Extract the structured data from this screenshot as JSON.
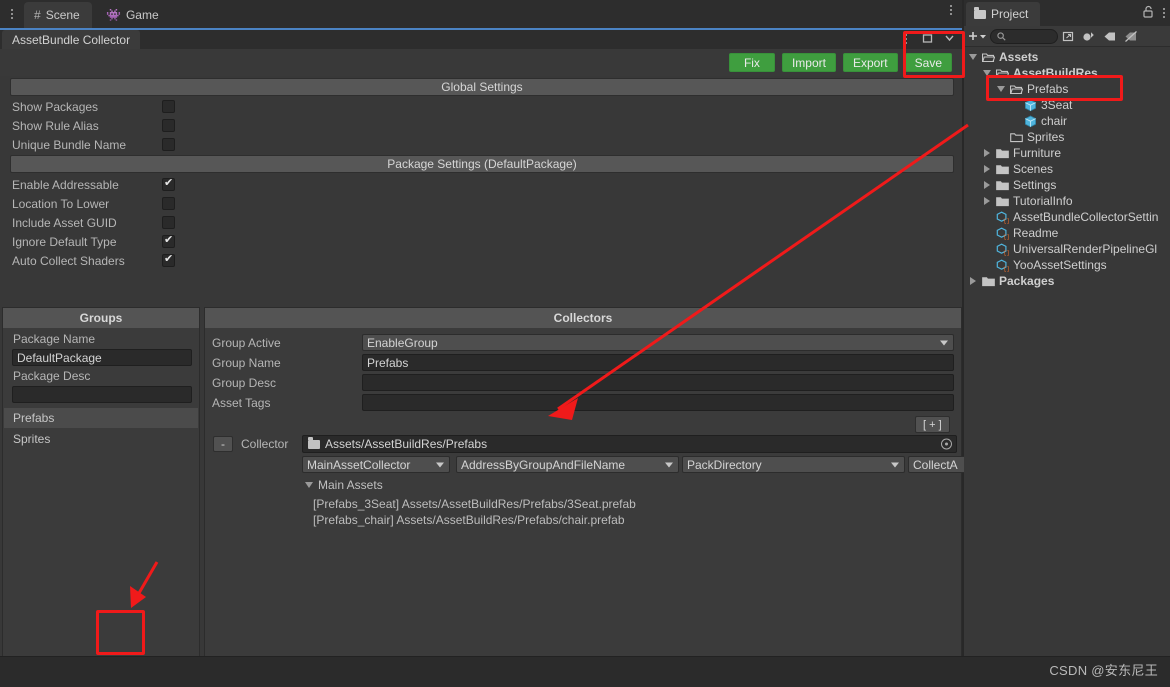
{
  "editor_tabs": [
    {
      "label": "Scene",
      "icon": "grid-icon",
      "active": true
    },
    {
      "label": "Game",
      "icon": "gamepad-icon",
      "active": false
    }
  ],
  "abc_window": {
    "tab_label": "AssetBundle Collector",
    "toolbar": {
      "fix_label": "Fix",
      "import_label": "Import",
      "export_label": "Export",
      "save_label": "Save",
      "button_color": "#3f9e3f"
    },
    "window_controls": {
      "kebab": "⋮",
      "maximize": "▭",
      "close": "✕"
    }
  },
  "global_settings": {
    "header": "Global Settings",
    "options": [
      {
        "label": "Show Packages",
        "checked": false
      },
      {
        "label": "Show Rule Alias",
        "checked": false
      },
      {
        "label": "Unique Bundle Name",
        "checked": false
      }
    ]
  },
  "package_settings": {
    "header": "Package Settings (DefaultPackage)",
    "options": [
      {
        "label": "Enable Addressable",
        "checked": true
      },
      {
        "label": "Location To Lower",
        "checked": false
      },
      {
        "label": "Include Asset GUID",
        "checked": false
      },
      {
        "label": "Ignore Default Type",
        "checked": true
      },
      {
        "label": "Auto Collect Shaders",
        "checked": true
      }
    ]
  },
  "groups": {
    "title": "Groups",
    "package_name_label": "Package Name",
    "package_name_value": "DefaultPackage",
    "package_desc_label": "Package Desc",
    "package_desc_value": "",
    "items": [
      {
        "label": "Prefabs",
        "selected": true
      },
      {
        "label": "Sprites",
        "selected": false
      }
    ],
    "remove_button": "-",
    "add_button": "+"
  },
  "collectors": {
    "title": "Collectors",
    "fields": [
      {
        "label": "Group Active",
        "value": "EnableGroup",
        "type": "popup"
      },
      {
        "label": "Group Name",
        "value": "Prefabs",
        "type": "text"
      },
      {
        "label": "Group Desc",
        "value": "",
        "type": "text"
      },
      {
        "label": "Asset Tags",
        "value": "",
        "type": "text"
      }
    ],
    "add_collector_button": "[ + ]",
    "collector_remove_button": "-",
    "collector_label": "Collector",
    "collector_path": "Assets/AssetBuildRes/Prefabs",
    "dropdowns": [
      {
        "value": "MainAssetCollector"
      },
      {
        "value": "AddressByGroupAndFileName"
      },
      {
        "value": "PackDirectory"
      },
      {
        "value": "CollectA"
      }
    ],
    "main_assets_label": "Main Assets",
    "assets": [
      "[Prefabs_3Seat] Assets/AssetBuildRes/Prefabs/3Seat.prefab",
      "[Prefabs_chair] Assets/AssetBuildRes/Prefabs/chair.prefab"
    ]
  },
  "project": {
    "tab_label": "Project",
    "tab_icon": "folder-icon",
    "lock_icon": "lock-open-icon",
    "kebab_icon": "kebab-menu-icon",
    "toolbar": {
      "add_label": "+",
      "search_placeholder": "",
      "search_icon": "search-icon",
      "icons": [
        "open-in-new-icon",
        "filter-by-type-icon",
        "filter-by-label-icon",
        "hidden-packages-icon"
      ]
    },
    "tree": [
      {
        "label": "Assets",
        "depth": 0,
        "twisty": "down",
        "icon": "folder-open-icon",
        "bold": true,
        "highlighted": false
      },
      {
        "label": "AssetBuildRes",
        "depth": 1,
        "twisty": "down",
        "icon": "folder-open-icon",
        "bold": true,
        "highlighted": false
      },
      {
        "label": "Prefabs",
        "depth": 2,
        "twisty": "down",
        "icon": "folder-open-icon",
        "bold": false,
        "highlighted": true
      },
      {
        "label": "3Seat",
        "depth": 3,
        "twisty": "none",
        "icon": "prefab-cube-icon",
        "bold": false,
        "highlighted": false
      },
      {
        "label": "chair",
        "depth": 3,
        "twisty": "none",
        "icon": "prefab-cube-icon",
        "bold": false,
        "highlighted": false
      },
      {
        "label": "Sprites",
        "depth": 2,
        "twisty": "none",
        "icon": "folder-icon",
        "bold": false,
        "highlighted": false
      },
      {
        "label": "Furniture",
        "depth": 1,
        "twisty": "right",
        "icon": "folder-icon",
        "bold": false,
        "highlighted": false
      },
      {
        "label": "Scenes",
        "depth": 1,
        "twisty": "right",
        "icon": "folder-icon",
        "bold": false,
        "highlighted": false
      },
      {
        "label": "Settings",
        "depth": 1,
        "twisty": "right",
        "icon": "folder-icon",
        "bold": false,
        "highlighted": false
      },
      {
        "label": "TutorialInfo",
        "depth": 1,
        "twisty": "right",
        "icon": "folder-icon",
        "bold": false,
        "highlighted": false
      },
      {
        "label": "AssetBundleCollectorSettin",
        "depth": 1,
        "twisty": "none",
        "icon": "scriptable-object-icon",
        "bold": false,
        "highlighted": false
      },
      {
        "label": "Readme",
        "depth": 1,
        "twisty": "none",
        "icon": "scriptable-object-icon",
        "bold": false,
        "highlighted": false
      },
      {
        "label": "UniversalRenderPipelineGl",
        "depth": 1,
        "twisty": "none",
        "icon": "scriptable-object-icon",
        "bold": false,
        "highlighted": false
      },
      {
        "label": "YooAssetSettings",
        "depth": 1,
        "twisty": "none",
        "icon": "scriptable-object-icon",
        "bold": false,
        "highlighted": false
      },
      {
        "label": "Packages",
        "depth": 0,
        "twisty": "right",
        "icon": "folder-icon",
        "bold": true,
        "highlighted": false
      }
    ]
  },
  "annotations": {
    "color": "#f01a1a",
    "boxes": [
      "save-button-highlight",
      "prefabs-tree-highlight",
      "add-group-button-highlight"
    ],
    "arrows": [
      "prefabs-to-collector-arrow",
      "pointer-to-add-button-arrow"
    ]
  },
  "watermark": {
    "text": "CSDN @安东尼王"
  }
}
